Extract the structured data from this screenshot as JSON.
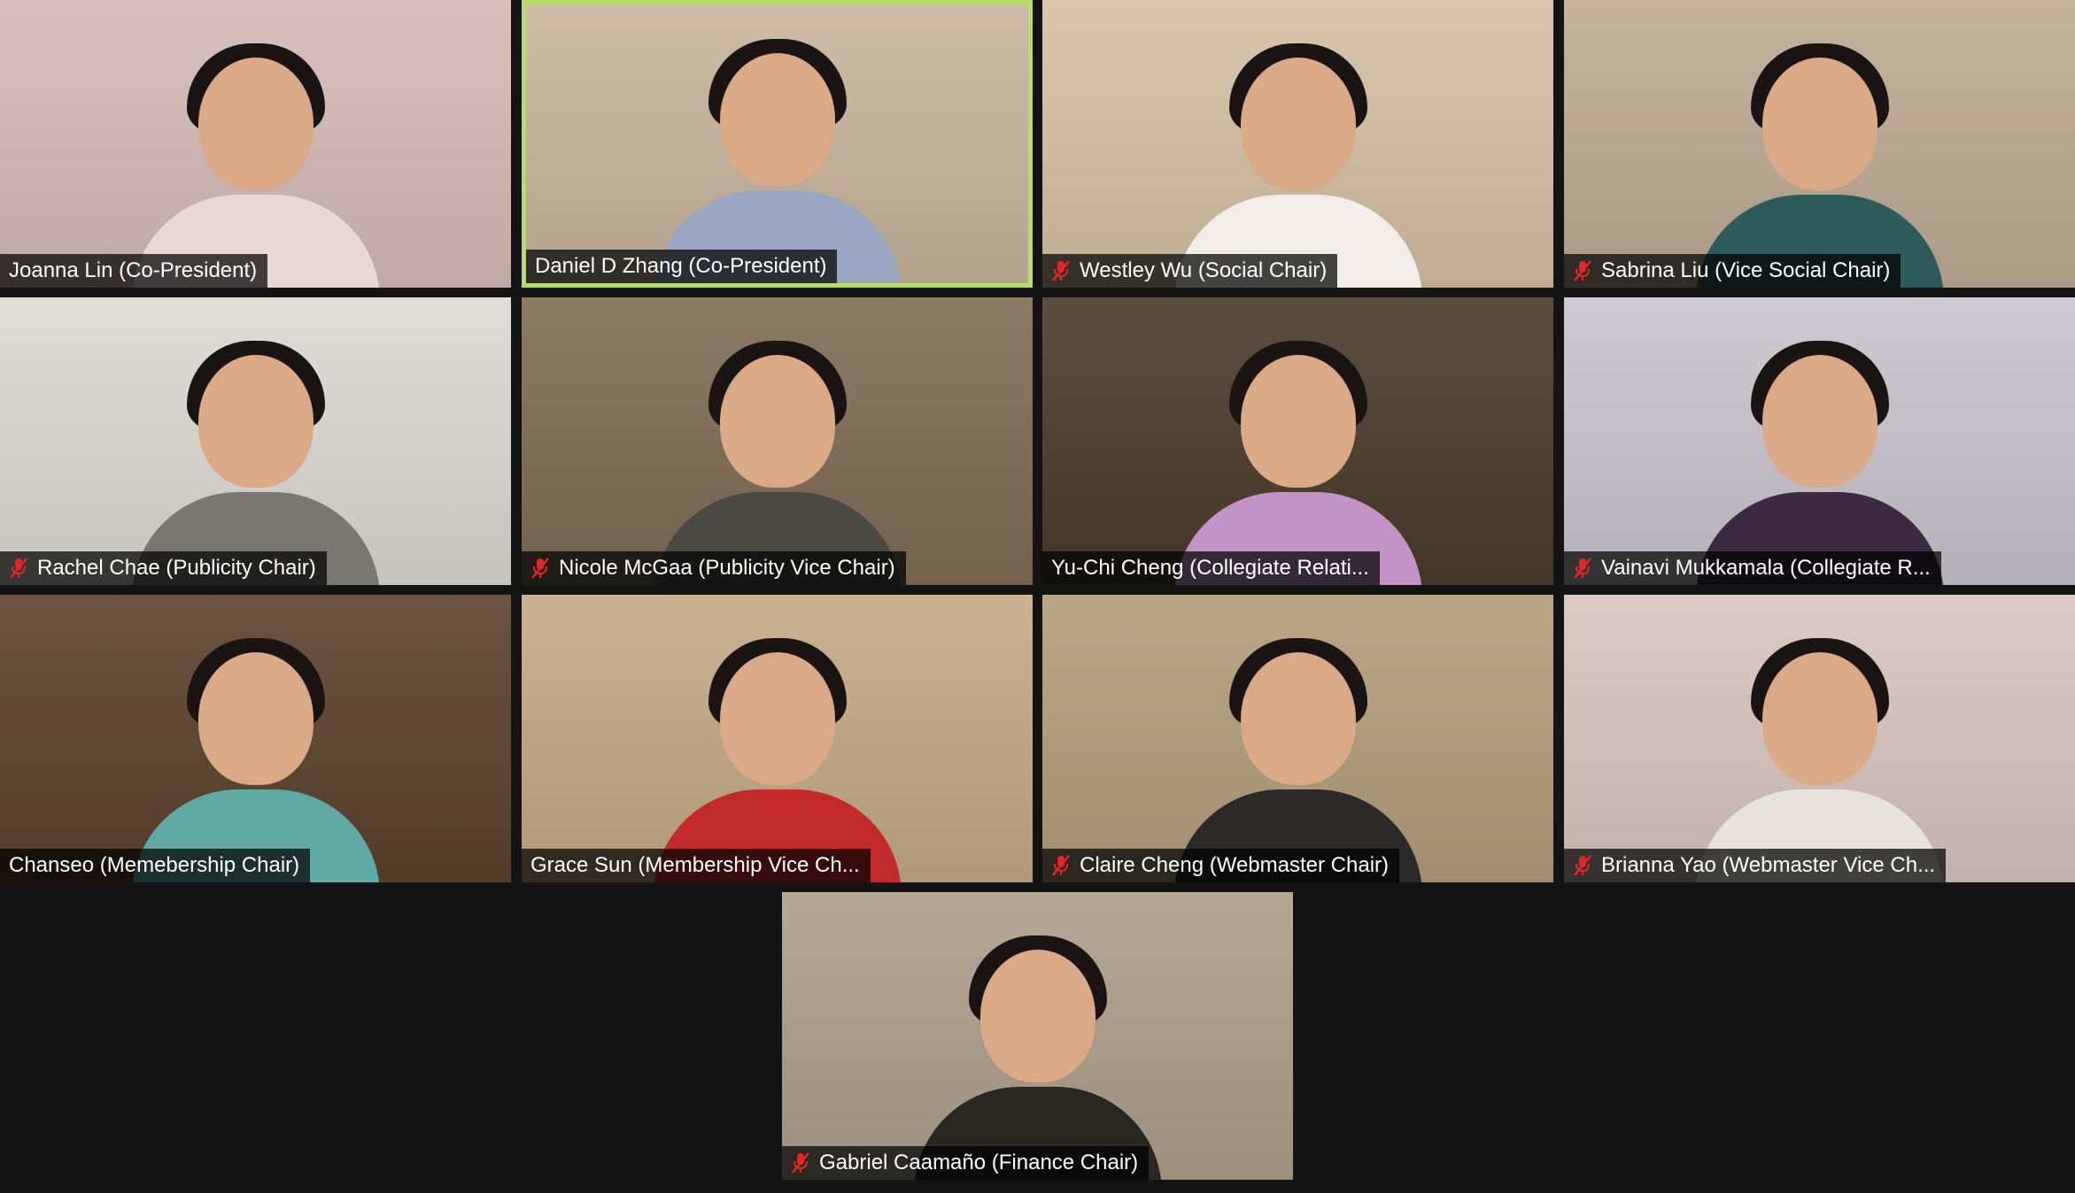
{
  "meeting": {
    "view": "gallery",
    "active_speaker": "Daniel D Zhang (Co-President)"
  },
  "participants": [
    {
      "name": "Joanna Lin (Co-President)",
      "muted": false,
      "active": false,
      "bg": "#d8c2c0",
      "shirt": "#e9d8d2"
    },
    {
      "name": "Daniel D Zhang (Co-President)",
      "muted": false,
      "active": true,
      "bg": "#cdbca6",
      "shirt": "#9aa6c2"
    },
    {
      "name": "Westley Wu (Social Chair)",
      "muted": true,
      "active": false,
      "bg": "#d8c7ad",
      "shirt": "#f2ede8"
    },
    {
      "name": "Sabrina Liu (Vice Social Chair)",
      "muted": true,
      "active": false,
      "bg": "#c4b39e",
      "shirt": "#2e5a5c"
    },
    {
      "name": "Rachel Chae (Publicity Chair)",
      "muted": true,
      "active": false,
      "bg": "#e0dcd6",
      "shirt": "#7a7773"
    },
    {
      "name": "Nicole McGaa (Publicity Vice Chair)",
      "muted": true,
      "active": false,
      "bg": "#8a7a66",
      "shirt": "#4a4a42"
    },
    {
      "name": "Yu-Chi  Cheng (Collegiate Relati...",
      "muted": false,
      "active": false,
      "bg": "#5c4e40",
      "shirt": "#c294c6"
    },
    {
      "name": "Vainavi Mukkamala (Collegiate R...",
      "muted": true,
      "active": false,
      "bg": "#cfcad2",
      "shirt": "#3c2a44"
    },
    {
      "name": "Chanseo (Memebership Chair)",
      "muted": false,
      "active": false,
      "bg": "#6b5442",
      "shirt": "#5fa8a4"
    },
    {
      "name": "Grace Sun (Membership Vice Ch...",
      "muted": false,
      "active": false,
      "bg": "#c9b291",
      "shirt": "#c22b2b"
    },
    {
      "name": "Claire Cheng (Webmaster Chair)",
      "muted": true,
      "active": false,
      "bg": "#b9a788",
      "shirt": "#2c2a28"
    },
    {
      "name": "Brianna Yao (Webmaster Vice Ch...",
      "muted": true,
      "active": false,
      "bg": "#dccbc4",
      "shirt": "#e8e2dc"
    },
    {
      "name": "Gabriel Caamaño (Finance Chair)",
      "muted": true,
      "active": false,
      "bg": "#b6a896",
      "shirt": "#2a2622"
    }
  ],
  "colors": {
    "active_border": "#b8dc6a",
    "muted_icon": "#e02828",
    "name_text": "#ffffff"
  },
  "icons": {
    "muted": "mic-muted-icon"
  }
}
